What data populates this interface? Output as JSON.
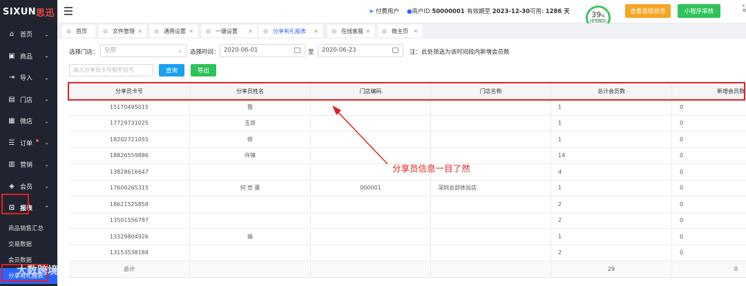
{
  "brand": {
    "logo_main": "SIXUN",
    "logo_cn": "思迅"
  },
  "sidebar": {
    "items": [
      {
        "label": "首页",
        "icon": "home-icon"
      },
      {
        "label": "商品",
        "icon": "gift-icon"
      },
      {
        "label": "导入",
        "icon": "import-icon"
      },
      {
        "label": "门店",
        "icon": "store-icon"
      },
      {
        "label": "微店",
        "icon": "shop-icon"
      },
      {
        "label": "订单",
        "icon": "order-icon"
      },
      {
        "label": "营销",
        "icon": "chart-icon"
      },
      {
        "label": "会员",
        "icon": "diamond-icon"
      },
      {
        "label": "报表",
        "icon": "lock-icon"
      }
    ],
    "sub_items": [
      "商品销售汇总",
      "交易数据",
      "会员数据",
      "分享有礼报表"
    ]
  },
  "topbar": {
    "user_type": "付费用户",
    "merchant_label": "商户ID:",
    "merchant_id": "50000001",
    "valid_label": "有效期至",
    "valid_date": "2023-12-30",
    "available_label": "可用:",
    "available_days": "1286 天",
    "progress_pct": "39",
    "progress_unit": "%",
    "speed": "0.02K/s",
    "btn_connect": "查看连接状态",
    "btn_miniapp": "小程序审核",
    "corner_text": "K 管"
  },
  "tabs": [
    "首页",
    "文件管理",
    "通用设置",
    "一键设置",
    "分享有礼报表",
    "在线客服",
    "微主页"
  ],
  "filters": {
    "store_label": "选择门店：",
    "store_placeholder": "全部",
    "time_label": "选择时间：",
    "date_from": "2020-06-01",
    "to_label": "至",
    "date_to": "2020-06-23",
    "note": "注：此处筛选为该时间段内新增会员数",
    "search_placeholder": "输入分享员卡号和手机号",
    "btn_query": "查询",
    "btn_export": "导出"
  },
  "table": {
    "headers": [
      "分享员卡号",
      "分享员姓名",
      "门店编码",
      "门店名称",
      "总计会员数",
      "新增会员数"
    ],
    "rows": [
      [
        "15170495015",
        "我",
        "",
        "",
        "1",
        "0"
      ],
      [
        "17729731025",
        "玉良",
        "",
        "",
        "1",
        "0"
      ],
      [
        "18202721055",
        "徐",
        "",
        "",
        "1",
        "0"
      ],
      [
        "18826559886",
        "许锋",
        "",
        "",
        "14",
        "0"
      ],
      [
        "13828616647",
        "",
        "",
        "",
        "4",
        "0"
      ],
      [
        "17600265315",
        "何 世 豪",
        "000001",
        "深圳总部体验店",
        "1",
        "0"
      ],
      [
        "18621525858",
        "",
        "",
        "",
        "2",
        "0"
      ],
      [
        "13501556787",
        "",
        "",
        "",
        "2",
        "0"
      ],
      [
        "13329804926",
        "搞",
        "",
        "",
        "1",
        "0"
      ],
      [
        "13153538188",
        "",
        "",
        "",
        "2",
        "0"
      ]
    ],
    "total_label": "总计",
    "total_members": "29",
    "total_new": "0"
  },
  "annotation": "分享员信息一目了然",
  "watermark": "大数跨境"
}
